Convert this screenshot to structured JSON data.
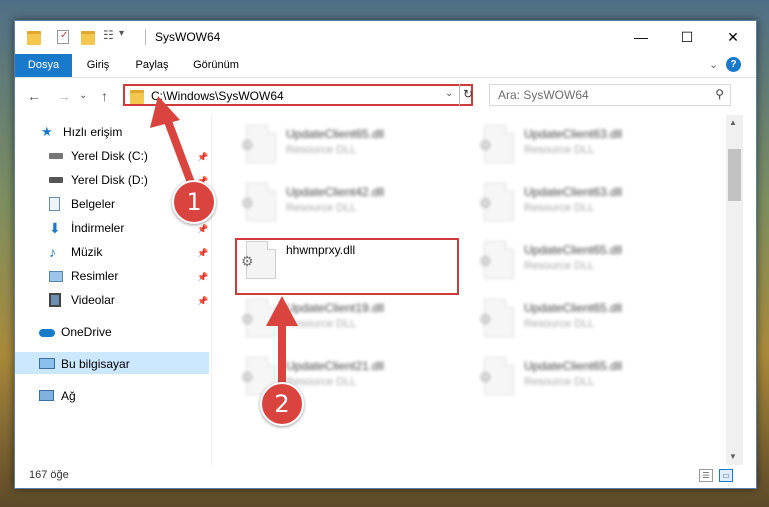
{
  "window": {
    "title": "SysWOW64",
    "controls": {
      "minimize": "—",
      "maximize": "☐",
      "close": "✕"
    }
  },
  "ribbon": {
    "tabs": [
      "Dosya",
      "Giriş",
      "Paylaş",
      "Görünüm"
    ],
    "expand": "⌄",
    "help": "?"
  },
  "address": {
    "path": "C:\\Windows\\SysWOW64",
    "dropdown": "⌄",
    "refresh": "↻"
  },
  "search": {
    "placeholder": "Ara: SysWOW64",
    "icon": "🔍"
  },
  "nav": {
    "back": "←",
    "forward": "→",
    "recent": "⌄",
    "up": "↑",
    "items": [
      {
        "label": "Hızlı erişim",
        "icon": "star-icon"
      },
      {
        "label": "Yerel Disk (C:)",
        "icon": "drive-icon"
      },
      {
        "label": "Yerel Disk (D:)",
        "icon": "drive-icon"
      },
      {
        "label": "Belgeler",
        "icon": "documents-icon"
      },
      {
        "label": "İndirmeler",
        "icon": "download-icon"
      },
      {
        "label": "Müzik",
        "icon": "music-icon"
      },
      {
        "label": "Resimler",
        "icon": "pictures-icon"
      },
      {
        "label": "Videolar",
        "icon": "video-icon"
      },
      {
        "label": "OneDrive",
        "icon": "cloud-icon"
      },
      {
        "label": "Bu bilgisayar",
        "icon": "computer-icon"
      },
      {
        "label": "Ağ",
        "icon": "network-icon"
      }
    ],
    "pin": "📌"
  },
  "files": [
    {
      "name": "UpdateClient65.dll",
      "type": "Resource DLL"
    },
    {
      "name": "UpdateClient63.dll",
      "type": "Resource DLL"
    },
    {
      "name": "UpdateClient42.dll",
      "type": "Resource DLL"
    },
    {
      "name": "UpdateClient63.dll",
      "type": "Resource DLL"
    },
    {
      "name": "hhwmprxy.dll",
      "type": ""
    },
    {
      "name": "UpdateClient65.dll",
      "type": "Resource DLL"
    },
    {
      "name": "UpdateClient19.dll",
      "type": "Resource DLL"
    },
    {
      "name": "UpdateClient65.dll",
      "type": "Resource DLL"
    },
    {
      "name": "UpdateClient21.dll",
      "type": "Resource DLL"
    },
    {
      "name": "UpdateClient65.dll",
      "type": "Resource DLL"
    }
  ],
  "status": {
    "count": "167 öğe"
  },
  "callouts": [
    "1",
    "2"
  ],
  "colors": {
    "accent": "#1979ca",
    "highlight": "#d13a3a",
    "selection": "#cce8ff"
  }
}
